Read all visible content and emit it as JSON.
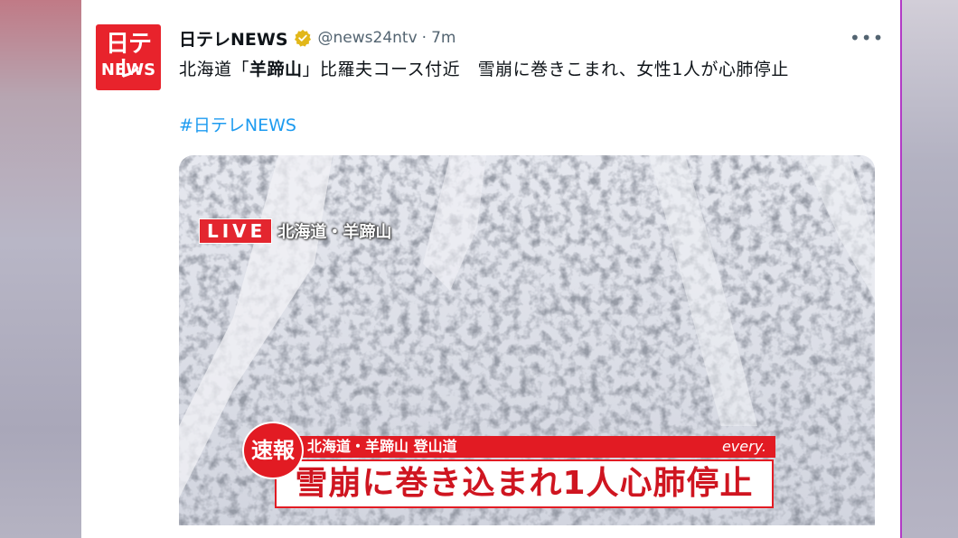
{
  "tweet": {
    "avatar_top": "日テレ",
    "avatar_bottom": "NEWS",
    "display_name": "日テレNEWS",
    "handle": "@news24ntv",
    "separator": "·",
    "time": "7m",
    "more": "•••",
    "text_prefix": "北海道「",
    "text_bold": "羊蹄山",
    "text_suffix": "」比羅夫コース付近　雪崩に巻きこまれ、女性1人が心肺停止",
    "hashtag": "#日テレNEWS"
  },
  "media": {
    "live_badge": "LIVE",
    "live_location": "北海道・羊蹄山",
    "breaking_label": "速報",
    "sub_caption": "北海道・羊蹄山 登山道",
    "network": "every.",
    "headline": "雪崩に巻き込まれ1人心肺停止"
  },
  "colors": {
    "brand_red": "#e8232c",
    "hashtag_blue": "#1d9bf0",
    "verified_gold": "#e2b719",
    "muted_text": "#536471"
  }
}
